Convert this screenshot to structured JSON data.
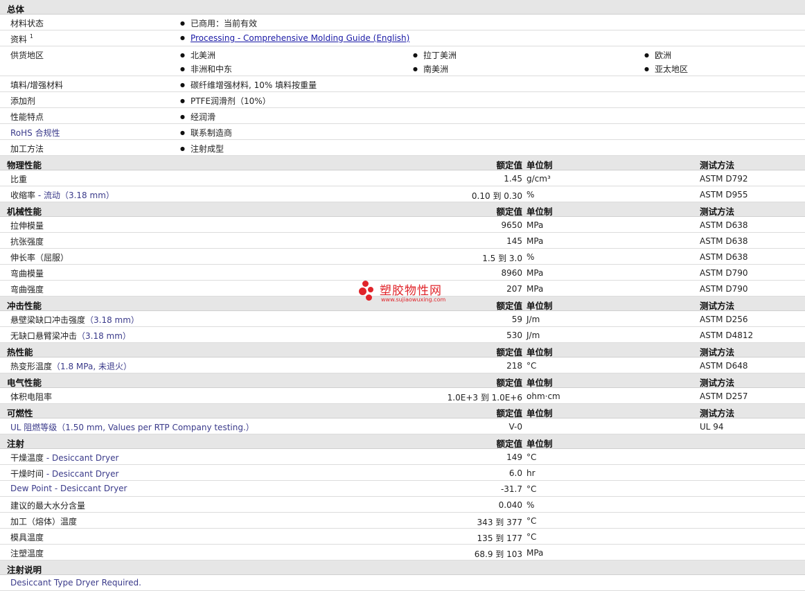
{
  "general": {
    "title": "总体",
    "material_status": {
      "label": "材料状态",
      "value": "已商用：当前有效"
    },
    "documents": {
      "label": "资料",
      "footnote": "1",
      "link": "Processing - Comprehensive Molding Guide (English)"
    },
    "regions": {
      "label": "供货地区",
      "items": [
        "北美洲",
        "拉丁美洲",
        "欧洲",
        "非洲和中东",
        "南美洲",
        "亚太地区"
      ]
    },
    "filler": {
      "label": "填料/增强材料",
      "value": "碳纤维增强材料, 10% 填料按重量"
    },
    "additive": {
      "label": "添加剂",
      "value": "PTFE润滑剂（10%）"
    },
    "features": {
      "label": "性能特点",
      "value": "经润滑"
    },
    "rohs": {
      "label": "RoHS 合规性",
      "value": "联系制造商"
    },
    "processing": {
      "label": "加工方法",
      "value": "注射成型"
    }
  },
  "cols": {
    "value": "额定值",
    "unit": "单位制",
    "method": "测试方法"
  },
  "physical": {
    "title": "物理性能",
    "rows": [
      {
        "label": "比重",
        "qual": "",
        "value": "1.45",
        "unit": "g/cm³",
        "method": "ASTM D792"
      },
      {
        "label": "收缩率",
        "qual": " - 流动（3.18 mm）",
        "value": "0.10 到  0.30",
        "unit": "%",
        "method": "ASTM D955"
      }
    ]
  },
  "mechanical": {
    "title": "机械性能",
    "rows": [
      {
        "label": "拉伸模量",
        "qual": "",
        "value": "9650",
        "unit": "MPa",
        "method": "ASTM D638"
      },
      {
        "label": "抗张强度",
        "qual": "",
        "value": "145",
        "unit": "MPa",
        "method": "ASTM D638"
      },
      {
        "label": "伸长率（屈服）",
        "qual": "",
        "value": "1.5 到  3.0",
        "unit": "%",
        "method": "ASTM D638"
      },
      {
        "label": "弯曲模量",
        "qual": "",
        "value": "8960",
        "unit": "MPa",
        "method": "ASTM D790"
      },
      {
        "label": "弯曲强度",
        "qual": "",
        "value": "207",
        "unit": "MPa",
        "method": "ASTM D790"
      }
    ]
  },
  "impact": {
    "title": "冲击性能",
    "rows": [
      {
        "label": "悬壁梁缺口冲击强度",
        "qual": "（3.18 mm）",
        "value": "59",
        "unit": "J/m",
        "method": "ASTM D256"
      },
      {
        "label": "无缺口悬臂梁冲击",
        "qual": "（3.18 mm）",
        "value": "530",
        "unit": "J/m",
        "method": "ASTM D4812"
      }
    ]
  },
  "thermal": {
    "title": "热性能",
    "rows": [
      {
        "label": "热变形温度",
        "qual": "（1.8 MPa, 未退火）",
        "value": "218",
        "unit": "°C",
        "method": "ASTM D648"
      }
    ]
  },
  "electrical": {
    "title": "电气性能",
    "rows": [
      {
        "label": "体积电阻率",
        "qual": "",
        "value": "1.0E+3 到  1.0E+6",
        "unit": "ohm·cm",
        "method": "ASTM D257"
      }
    ]
  },
  "flammability": {
    "title": "可燃性",
    "rows": [
      {
        "label": "UL 阻燃等级",
        "qual": "（1.50 mm, Values per RTP Company testing.）",
        "value": "V-0",
        "unit": "",
        "method": "UL 94"
      }
    ]
  },
  "injection": {
    "title": "注射",
    "rows": [
      {
        "label": "干燥温度",
        "qual": " - Desiccant Dryer",
        "value": "149",
        "unit": "°C"
      },
      {
        "label": "干燥时间",
        "qual": " - Desiccant Dryer",
        "value": "6.0",
        "unit": "hr"
      },
      {
        "label": "Dew Point - Desiccant Dryer",
        "qual": "",
        "value": "-31.7",
        "unit": "°C"
      },
      {
        "label": "建议的最大水分含量",
        "qual": "",
        "value": "0.040",
        "unit": "%"
      },
      {
        "label": "加工（熔体）温度",
        "qual": "",
        "value": "343 到  377",
        "unit": "°C"
      },
      {
        "label": "模具温度",
        "qual": "",
        "value": "135 到  177",
        "unit": "°C"
      },
      {
        "label": "注塑温度",
        "qual": "",
        "value": "68.9 到  103",
        "unit": "MPa"
      }
    ]
  },
  "notes": {
    "title": "注射说明",
    "text": "Desiccant Type Dryer Required."
  },
  "watermark": {
    "brand": "塑胶物性网",
    "url": "www.sujiaowuxing.com",
    "color": "#e0242a"
  }
}
